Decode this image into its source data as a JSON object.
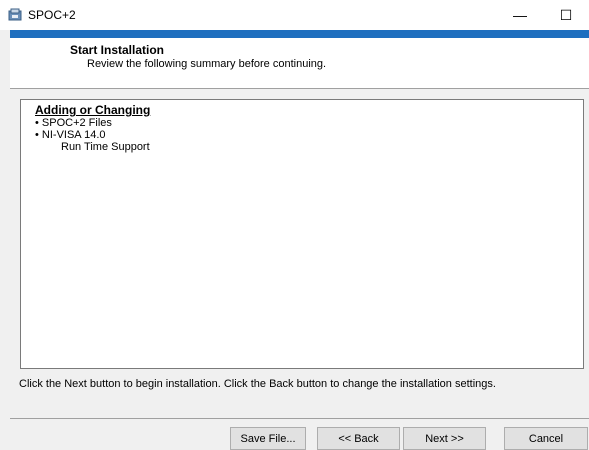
{
  "window": {
    "title": "SPOC+2",
    "minimize": "—",
    "maximize": "☐",
    "close": "✕"
  },
  "header": {
    "title": "Start Installation",
    "subtitle": "Review the following summary before continuing."
  },
  "summary": {
    "heading": "Adding or Changing",
    "items": [
      "• SPOC+2 Files",
      "• NI-VISA 14.0"
    ],
    "subitem": "Run Time Support"
  },
  "instructions": "Click the Next button to begin installation.  Click the Back button to change the installation settings.",
  "buttons": {
    "save": "Save File...",
    "back": "<< Back",
    "next": "Next >>",
    "cancel": "Cancel"
  }
}
